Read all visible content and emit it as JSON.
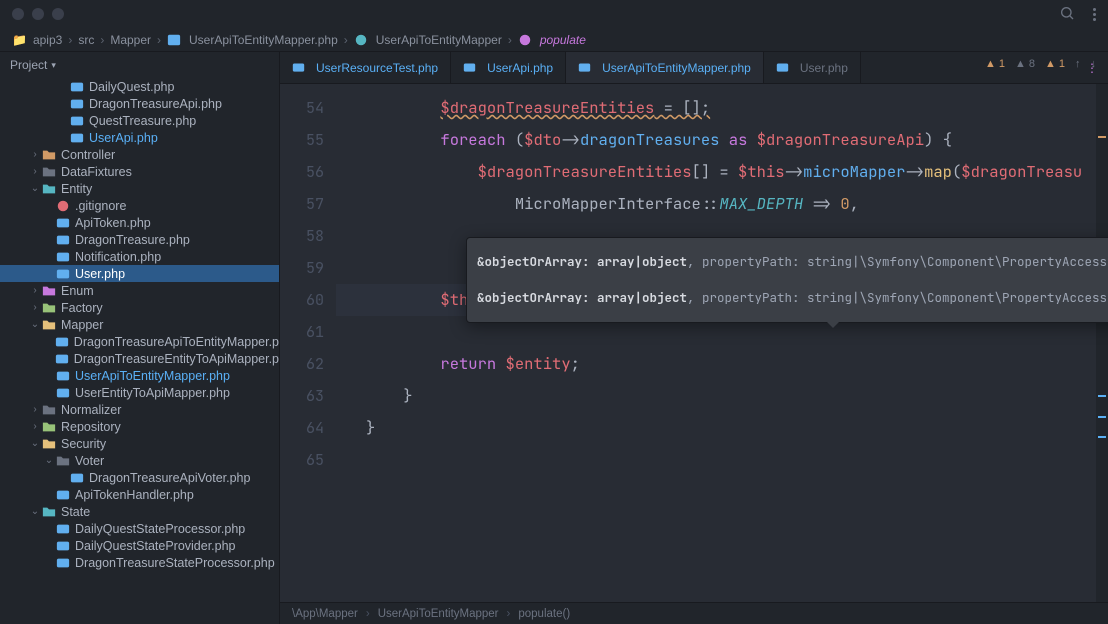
{
  "breadcrumbs": [
    "apip3",
    "src",
    "Mapper",
    "UserApiToEntityMapper.php",
    "UserApiToEntityMapper",
    "populate"
  ],
  "sidebar": {
    "header": "Project",
    "items": [
      {
        "label": "DailyQuest.php",
        "indent": 4,
        "type": "file",
        "icon": "php"
      },
      {
        "label": "DragonTreasureApi.php",
        "indent": 4,
        "type": "file",
        "icon": "php"
      },
      {
        "label": "QuestTreasure.php",
        "indent": 4,
        "type": "file",
        "icon": "php"
      },
      {
        "label": "UserApi.php",
        "indent": 4,
        "type": "file",
        "icon": "php",
        "hl": true
      },
      {
        "label": "Controller",
        "indent": 2,
        "type": "folder",
        "expanded": false,
        "color": "#d19a66"
      },
      {
        "label": "DataFixtures",
        "indent": 2,
        "type": "folder",
        "expanded": false
      },
      {
        "label": "Entity",
        "indent": 2,
        "type": "folder",
        "expanded": true,
        "color": "#56b6c2"
      },
      {
        "label": ".gitignore",
        "indent": 3,
        "type": "file",
        "icon": "git"
      },
      {
        "label": "ApiToken.php",
        "indent": 3,
        "type": "file",
        "icon": "php"
      },
      {
        "label": "DragonTreasure.php",
        "indent": 3,
        "type": "file",
        "icon": "php"
      },
      {
        "label": "Notification.php",
        "indent": 3,
        "type": "file",
        "icon": "php"
      },
      {
        "label": "User.php",
        "indent": 3,
        "type": "file",
        "icon": "php",
        "selected": true
      },
      {
        "label": "Enum",
        "indent": 2,
        "type": "folder",
        "expanded": false,
        "color": "#c678dd"
      },
      {
        "label": "Factory",
        "indent": 2,
        "type": "folder",
        "expanded": false,
        "color": "#98c379"
      },
      {
        "label": "Mapper",
        "indent": 2,
        "type": "folder",
        "expanded": true,
        "color": "#e5c07b"
      },
      {
        "label": "DragonTreasureApiToEntityMapper.p",
        "indent": 3,
        "type": "file",
        "icon": "php"
      },
      {
        "label": "DragonTreasureEntityToApiMapper.p",
        "indent": 3,
        "type": "file",
        "icon": "php"
      },
      {
        "label": "UserApiToEntityMapper.php",
        "indent": 3,
        "type": "file",
        "icon": "php",
        "hl": true
      },
      {
        "label": "UserEntityToApiMapper.php",
        "indent": 3,
        "type": "file",
        "icon": "php"
      },
      {
        "label": "Normalizer",
        "indent": 2,
        "type": "folder",
        "expanded": false
      },
      {
        "label": "Repository",
        "indent": 2,
        "type": "folder",
        "expanded": false,
        "color": "#98c379"
      },
      {
        "label": "Security",
        "indent": 2,
        "type": "folder",
        "expanded": true,
        "color": "#e5c07b"
      },
      {
        "label": "Voter",
        "indent": 3,
        "type": "folder",
        "expanded": true
      },
      {
        "label": "DragonTreasureApiVoter.php",
        "indent": 4,
        "type": "file",
        "icon": "php"
      },
      {
        "label": "ApiTokenHandler.php",
        "indent": 3,
        "type": "file",
        "icon": "php"
      },
      {
        "label": "State",
        "indent": 2,
        "type": "folder",
        "expanded": true,
        "color": "#56b6c2"
      },
      {
        "label": "DailyQuestStateProcessor.php",
        "indent": 3,
        "type": "file",
        "icon": "php"
      },
      {
        "label": "DailyQuestStateProvider.php",
        "indent": 3,
        "type": "file",
        "icon": "php"
      },
      {
        "label": "DragonTreasureStateProcessor.php",
        "indent": 3,
        "type": "file",
        "icon": "php"
      }
    ]
  },
  "tabs": [
    {
      "label": "UserResourceTest.php",
      "hl": true
    },
    {
      "label": "UserApi.php",
      "hl": true
    },
    {
      "label": "UserApiToEntityMapper.php",
      "active": true,
      "hl": true
    },
    {
      "label": "User.php"
    }
  ],
  "inspections": {
    "warn": "1",
    "weak": "8",
    "typo": "1"
  },
  "hint": {
    "row1_bold": "&objectOrArray: array|object",
    "row1_rest": ", propertyPath: string|\\Symfony\\Component\\PropertyAccess\\PropertyPathInterface, value: mixed",
    "row2_bold": "&objectOrArray: array|object",
    "row2_rest": ", propertyPath: string|\\Symfony\\Component\\PropertyAccess\\PropertyPathInterface, value: mixed"
  },
  "code": {
    "54": {
      "text": "$dragonTreasureEntities = [];"
    },
    "55": {
      "text": "foreach ($dto->dragonTreasures as $dragonTreasureApi) {"
    },
    "56": {
      "text": "$dragonTreasureEntities[] = $this->microMapper->map($dragonTreasu"
    },
    "57": {
      "text": "MicroMapperInterface::MAX_DEPTH => 0,"
    },
    "60": {
      "text": "$this->propertyAccessor->setValue();"
    },
    "62": {
      "text": "return $entity;"
    }
  },
  "bottom_crumbs": [
    "\\App\\Mapper",
    "UserApiToEntityMapper",
    "populate()"
  ]
}
